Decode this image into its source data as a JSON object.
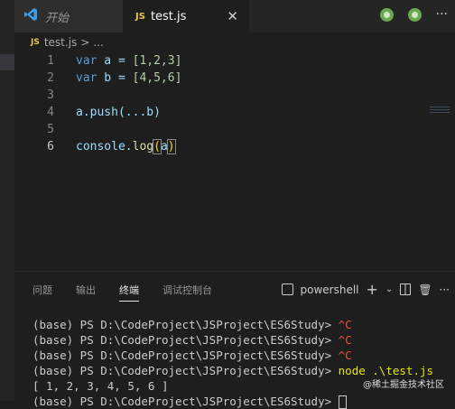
{
  "tabs": [
    {
      "label": "开始",
      "icon": "vscode-icon"
    },
    {
      "label": "test.js",
      "icon_text": "JS",
      "close": "✕"
    }
  ],
  "breadcrumb": {
    "icon_text": "JS",
    "file": "test.js",
    "sep": ">",
    "rest": "..."
  },
  "editor": {
    "lines": [
      {
        "n": "1"
      },
      {
        "n": "2"
      },
      {
        "n": "3"
      },
      {
        "n": "4"
      },
      {
        "n": "5"
      },
      {
        "n": "6"
      }
    ],
    "code": {
      "l1_kw": "var",
      "l1_rest": " a = ",
      "l1_arr": "[1,2,3]",
      "l2_kw": "var",
      "l2_rest": " b = ",
      "l2_arr": "[4,5,6]",
      "l4": "a.push(...b)",
      "l6_obj": "console.",
      "l6_fn": "log",
      "l6_open": "(",
      "l6_arg": "a",
      "l6_close": ")"
    }
  },
  "panel": {
    "tabs": [
      "问题",
      "输出",
      "终端",
      "调试控制台"
    ],
    "active_tab": "终端",
    "shell": "powershell",
    "terminal": {
      "prompt": "(base) PS D:\\CodeProject\\JSProject\\ES6Study> ",
      "lines": [
        {
          "cmd": "^C"
        },
        {
          "cmd": "^C"
        },
        {
          "cmd": "^C"
        },
        {
          "cmd": "node .\\test.js"
        }
      ],
      "output": "[ 1, 2, 3, 4, 5, 6 ]",
      "last_prompt": "(base) PS D:\\CodeProject\\JSProject\\ES6Study> "
    }
  },
  "watermark": "@稀土掘金技术社区",
  "colors": {
    "accent": "#e8c547",
    "keyword": "#569cd6",
    "error": "#f14c4c"
  }
}
